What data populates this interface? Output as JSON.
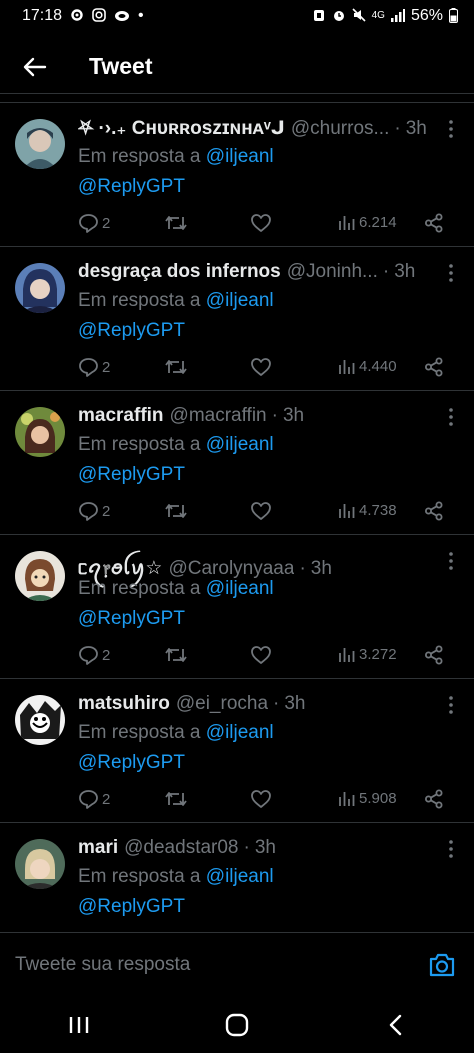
{
  "status_bar": {
    "time": "17:18",
    "dot": "•",
    "battery": "56%",
    "network": "4G"
  },
  "header": {
    "title": "Tweet",
    "back_icon": "arrow-left-icon"
  },
  "colors": {
    "background": "#000000",
    "primary_text": "#e7e9ea",
    "secondary_text": "#71767b",
    "link": "#1d9bf0",
    "divider": "#2f3336"
  },
  "replies_label": "Em resposta a",
  "tweets": [
    {
      "name": "⛧ ·›.₊ Cʜᴜʀʀᴏsᴢɪɴʜᴀᵛᒍ",
      "handle": "@churros...",
      "sep": "·",
      "time": "3h",
      "mention": "@iljeanl",
      "body": "@ReplyGPT",
      "replies": "2",
      "views": "6.214"
    },
    {
      "name": "desgraça dos infernos",
      "handle": "@Joninh...",
      "sep": "·",
      "time": "3h",
      "mention": "@iljeanl",
      "body": "@ReplyGPT",
      "replies": "2",
      "views": "4.440"
    },
    {
      "name": "macraffin",
      "handle": "@macraffin",
      "sep": "·",
      "time": "3h",
      "mention": "@iljeanl",
      "body": "@ReplyGPT",
      "replies": "2",
      "views": "4.738"
    },
    {
      "name": "ᥴꪖ᥅ꪮꪶꪗ☆",
      "handle": "@Carolynyaaa",
      "sep": "·",
      "time": "3h",
      "mention": "@iljeanl",
      "body": "@ReplyGPT",
      "replies": "2",
      "views": "3.272"
    },
    {
      "name": "matsuhiro",
      "handle": "@ei_rocha",
      "sep": "·",
      "time": "3h",
      "mention": "@iljeanl",
      "body": "@ReplyGPT",
      "replies": "2",
      "views": "5.908"
    },
    {
      "name": "mari",
      "handle": "@deadstar08",
      "sep": "·",
      "time": "3h",
      "mention": "@iljeanl",
      "body": "@ReplyGPT",
      "replies": "",
      "views": ""
    }
  ],
  "compose": {
    "placeholder": "Tweete sua resposta"
  }
}
